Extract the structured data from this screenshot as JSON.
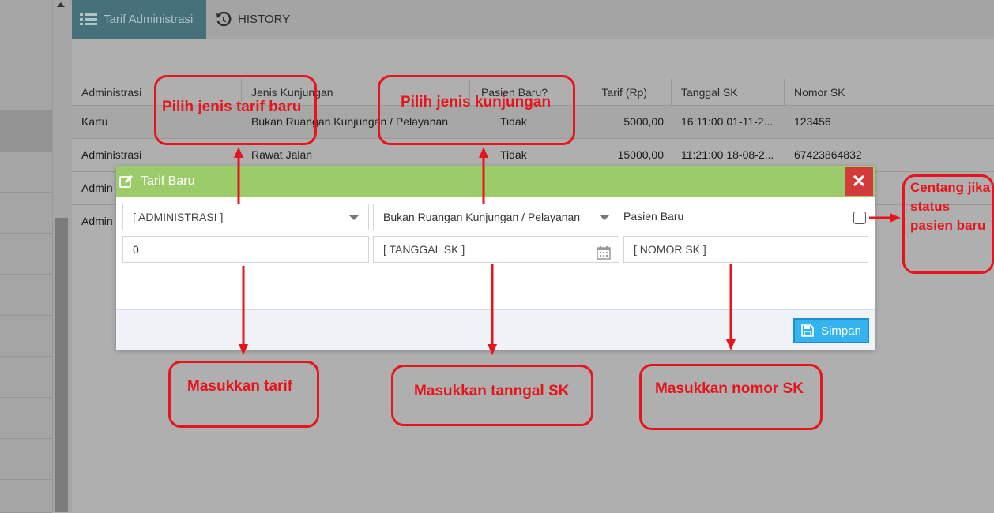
{
  "tabs": [
    {
      "label": "Tarif Administrasi",
      "icon": "list-icon",
      "active": true
    },
    {
      "label": "HISTORY",
      "icon": "history-icon",
      "active": false
    }
  ],
  "grid": {
    "columns": [
      "Administrasi",
      "Jenis Kunjungan",
      "Pasien Baru?",
      "Tarif (Rp)",
      "Tanggal SK",
      "Nomor SK"
    ],
    "rows": [
      [
        "Kartu",
        "Bukan Ruangan Kunjungan / Pelayanan",
        "Tidak",
        "5000,00",
        "16:11:00 01-11-2...",
        "123456"
      ],
      [
        "Administrasi",
        "Rawat Jalan",
        "Tidak",
        "15000,00",
        "11:21:00 18-08-2...",
        "67423864832"
      ],
      [
        "Admin",
        "",
        "",
        "",
        "",
        ""
      ],
      [
        "Admin",
        "",
        "",
        "",
        "",
        ""
      ]
    ]
  },
  "modal": {
    "title": "Tarif Baru",
    "administrasi_select": "[ ADMINISTRASI ]",
    "jenis_kunjungan_select": "Bukan Ruangan Kunjungan / Pelayanan",
    "pasien_baru_label": "Pasien Baru",
    "pasien_baru_checked": false,
    "tarif_value": "0",
    "tanggal_sk_placeholder": "[ TANGGAL SK ]",
    "nomor_sk_placeholder": "[ NOMOR SK ]",
    "save_label": "Simpan"
  },
  "annotations": {
    "pilih_tarif": "Pilih jenis tarif baru",
    "pilih_kunjungan": "Pilih jenis kunjungan",
    "centang": "Centang jika status pasien baru",
    "masukkan_tarif": "Masukkan tarif",
    "masukkan_tanggal": "Masukkan tanngal SK",
    "masukkan_nomor": "Masukkan nomor SK"
  },
  "colors": {
    "modal_header": "#9ccc6a",
    "active_tab": "#46707a",
    "close_button": "#d33b3b",
    "save_button": "#35b3ee",
    "annotation": "#e8141b"
  }
}
